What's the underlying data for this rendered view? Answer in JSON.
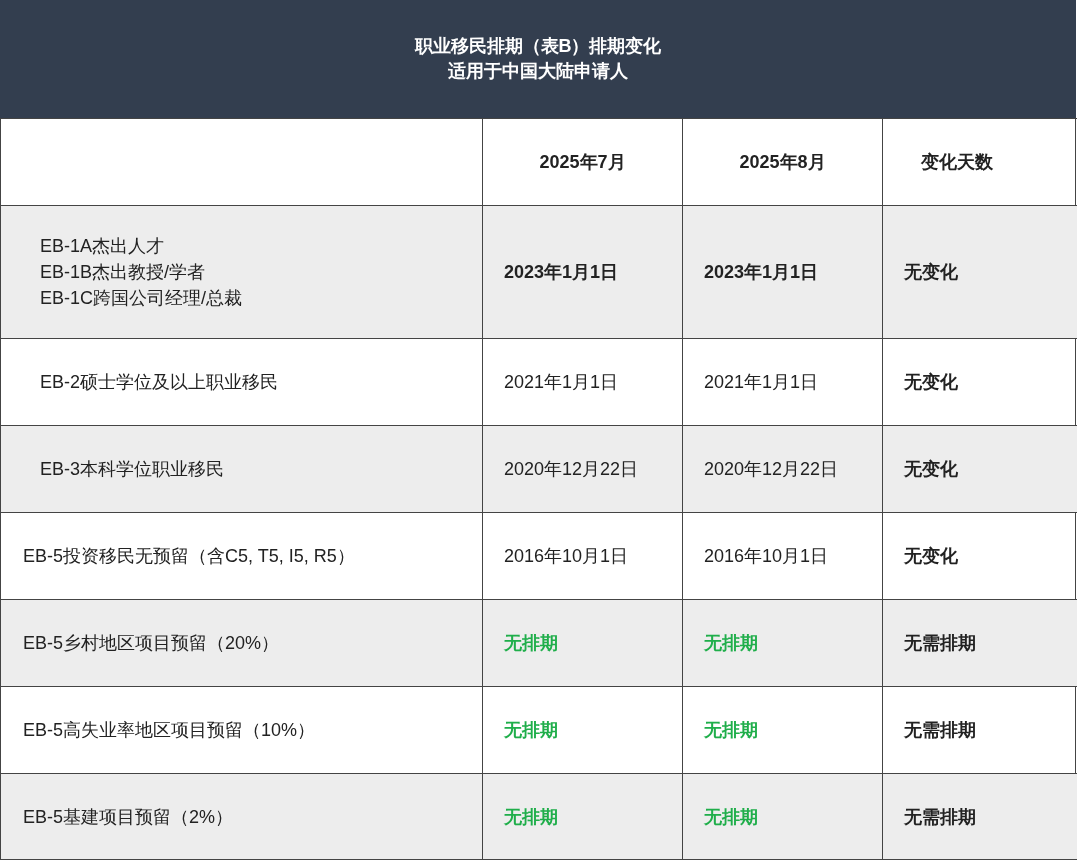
{
  "header": {
    "title": "职业移民排期（表B）排期变化",
    "subtitle": "适用于中国大陆申请人"
  },
  "columns": [
    "2025年7月",
    "2025年8月",
    "变化天数"
  ],
  "rows": [
    {
      "indented": true,
      "category": [
        "EB-1A杰出人才",
        "EB-1B杰出教授/学者",
        "EB-1C跨国公司经理/总裁"
      ],
      "cells": [
        {
          "kind": "bold",
          "text": "2023年1月1日"
        },
        {
          "kind": "bold",
          "text": "2023年1月1日"
        },
        {
          "kind": "bold",
          "text": "无变化"
        }
      ]
    },
    {
      "indented": true,
      "category": [
        "EB-2硕士学位及以上职业移民"
      ],
      "cells": [
        {
          "kind": "plain",
          "text": "2021年1月1日"
        },
        {
          "kind": "plain",
          "text": "2021年1月1日"
        },
        {
          "kind": "bold",
          "text": "无变化"
        }
      ]
    },
    {
      "indented": true,
      "category": [
        "EB-3本科学位职业移民"
      ],
      "cells": [
        {
          "kind": "plain",
          "text": "2020年12月22日"
        },
        {
          "kind": "plain",
          "text": "2020年12月22日"
        },
        {
          "kind": "bold",
          "text": "无变化"
        }
      ]
    },
    {
      "indented": false,
      "category": [
        "EB-5投资移民无预留（含C5, T5, I5, R5）"
      ],
      "cells": [
        {
          "kind": "plain",
          "text": "2016年10月1日"
        },
        {
          "kind": "plain",
          "text": "2016年10月1日"
        },
        {
          "kind": "bold",
          "text": "无变化"
        }
      ]
    },
    {
      "indented": false,
      "category": [
        "EB-5乡村地区项目预留（20%）"
      ],
      "cells": [
        {
          "kind": "current",
          "text": "无排期"
        },
        {
          "kind": "current",
          "text": "无排期"
        },
        {
          "kind": "bold",
          "text": "无需排期"
        }
      ]
    },
    {
      "indented": false,
      "category": [
        "EB-5高失业率地区项目预留（10%）"
      ],
      "cells": [
        {
          "kind": "current",
          "text": "无排期"
        },
        {
          "kind": "current",
          "text": "无排期"
        },
        {
          "kind": "bold",
          "text": "无需排期"
        }
      ]
    },
    {
      "indented": false,
      "category": [
        "EB-5基建项目预留（2%）"
      ],
      "cells": [
        {
          "kind": "current",
          "text": "无排期"
        },
        {
          "kind": "current",
          "text": "无排期"
        },
        {
          "kind": "bold",
          "text": "无需排期"
        }
      ]
    }
  ]
}
